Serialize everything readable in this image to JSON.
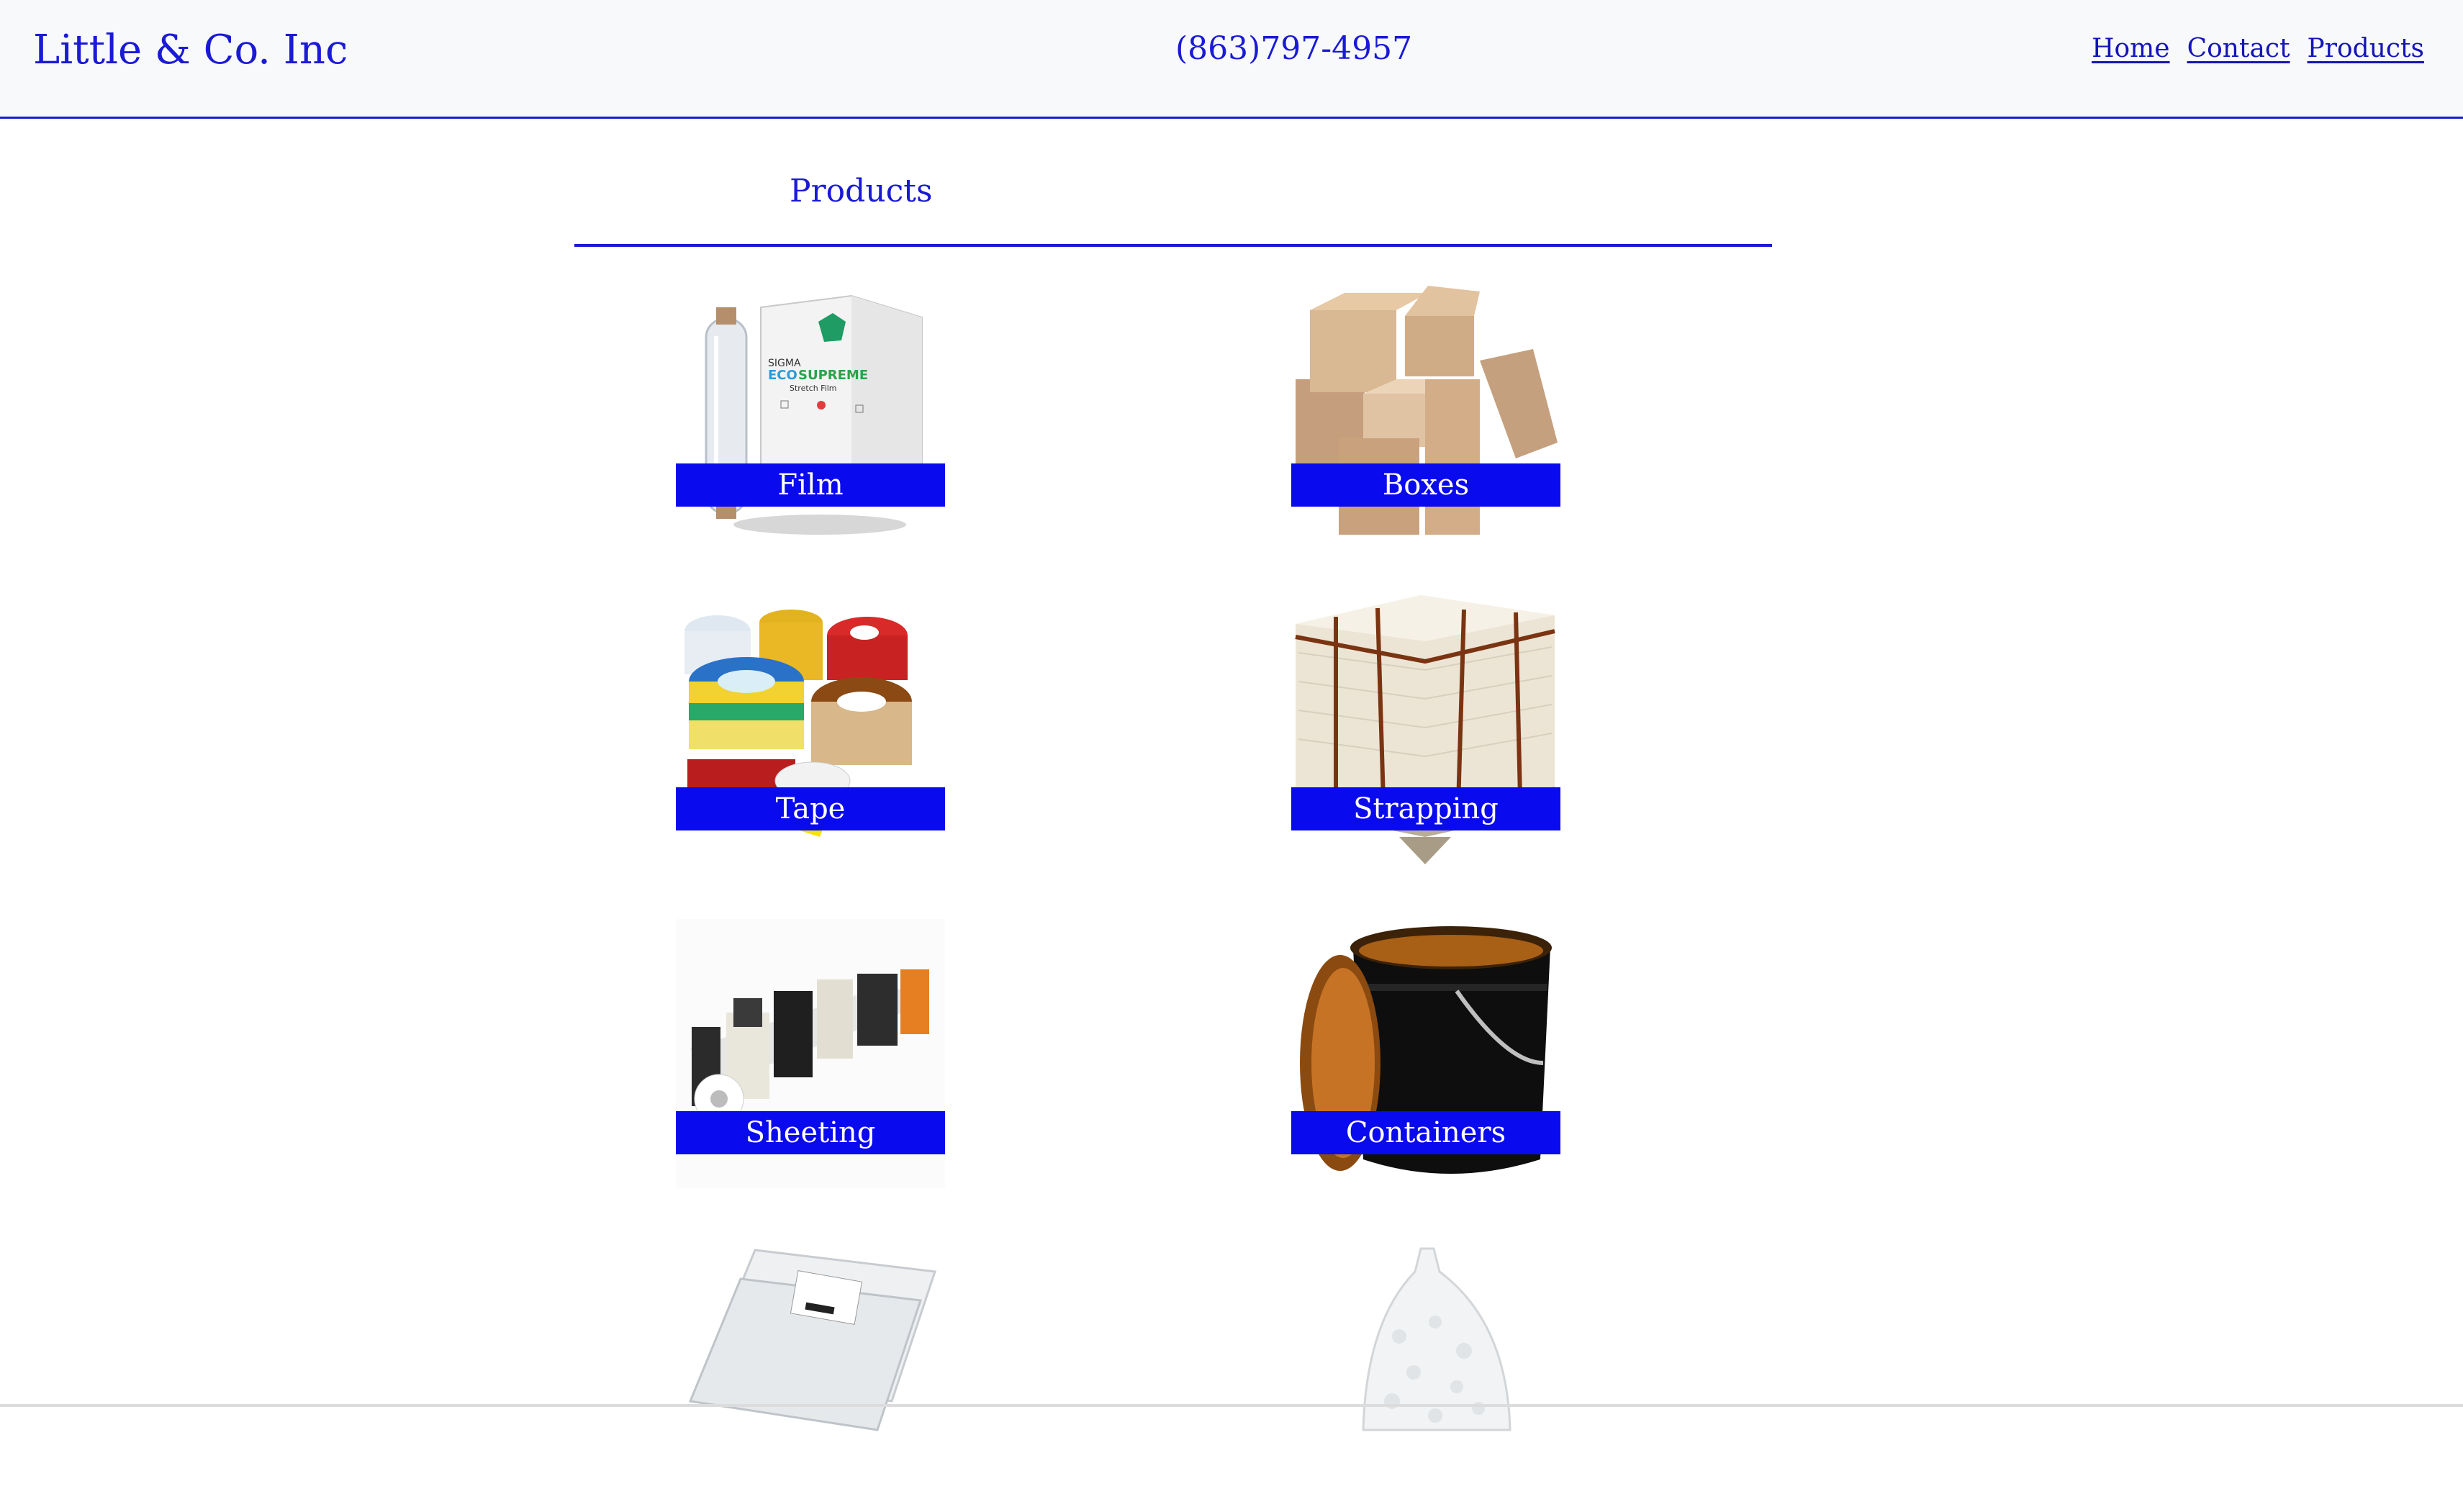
{
  "header": {
    "brand": "Little & Co. Inc",
    "phone": "(863)797-4957",
    "nav": [
      {
        "label": "Home"
      },
      {
        "label": "Contact"
      },
      {
        "label": "Products"
      }
    ]
  },
  "main": {
    "title": "Products",
    "products": [
      {
        "label": "Film",
        "icon": "stretch-film-image"
      },
      {
        "label": "Boxes",
        "icon": "cardboard-boxes-image"
      },
      {
        "label": "Tape",
        "icon": "tape-rolls-image"
      },
      {
        "label": "Strapping",
        "icon": "strapped-pallet-image"
      },
      {
        "label": "Sheeting",
        "icon": "sheeting-machine-image"
      },
      {
        "label": "Containers",
        "icon": "pail-container-image"
      },
      {
        "label": "",
        "icon": "poly-bags-image"
      },
      {
        "label": "",
        "icon": "packing-peanuts-bag-image"
      }
    ]
  },
  "colors": {
    "accent": "#1a1ad6",
    "label_bg": "#0a0aee",
    "header_bg": "#f8f9fa"
  }
}
